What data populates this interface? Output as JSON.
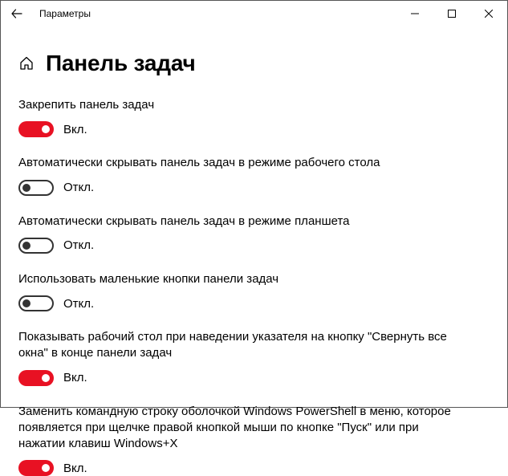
{
  "window": {
    "title": "Параметры"
  },
  "page": {
    "heading": "Панель задач"
  },
  "states": {
    "on": "Вкл.",
    "off": "Откл."
  },
  "settings": [
    {
      "label": "Закрепить панель задач",
      "on": true
    },
    {
      "label": "Автоматически скрывать панель задач в режиме рабочего стола",
      "on": false
    },
    {
      "label": "Автоматически скрывать панель задач в режиме планшета",
      "on": false
    },
    {
      "label": "Использовать маленькие кнопки панели задач",
      "on": false
    },
    {
      "label": "Показывать рабочий стол при наведении указателя на кнопку \"Свернуть все окна\" в конце панели задач",
      "on": true
    },
    {
      "label": "Заменить командную строку оболочкой Windows PowerShell в меню, которое появляется при щелчке правой кнопкой мыши по кнопке \"Пуск\" или при нажатии клавиш Windows+X",
      "on": true
    }
  ]
}
